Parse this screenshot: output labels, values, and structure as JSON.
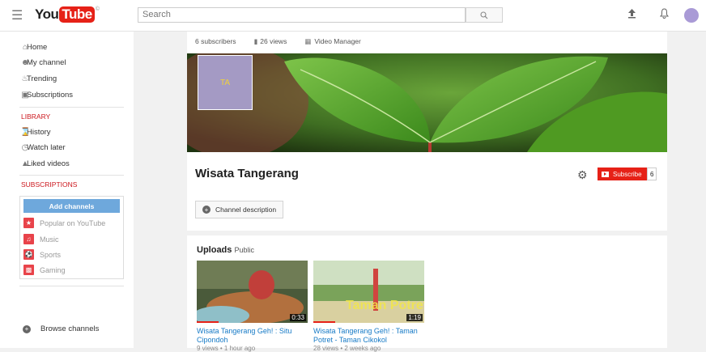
{
  "header": {
    "logo_you": "You",
    "logo_tube": "Tube",
    "search_placeholder": "Search"
  },
  "sidebar": {
    "nav": [
      {
        "label": "Home"
      },
      {
        "label": "My channel"
      },
      {
        "label": "Trending"
      },
      {
        "label": "Subscriptions"
      }
    ],
    "library_title": "LIBRARY",
    "library": [
      {
        "label": "History"
      },
      {
        "label": "Watch later"
      },
      {
        "label": "Liked videos"
      }
    ],
    "subscriptions_title": "SUBSCRIPTIONS",
    "add_channels": "Add channels",
    "subscriptions": [
      {
        "label": "Popular on YouTube",
        "color": "#e8434a"
      },
      {
        "label": "Music",
        "color": "#e8434a"
      },
      {
        "label": "Sports",
        "color": "#e8434a"
      },
      {
        "label": "Gaming",
        "color": "#e8434a"
      }
    ],
    "browse_channels": "Browse channels"
  },
  "channel": {
    "stats": {
      "subscribers": "6 subscribers",
      "views": "26 views",
      "manager": "Video Manager"
    },
    "thumb_text": "TA",
    "name": "Wisata Tangerang",
    "subscribe_label": "Subscribe",
    "subscriber_count": "6",
    "description_button": "Channel description"
  },
  "uploads": {
    "title": "Uploads",
    "visibility": "Public",
    "videos": [
      {
        "title": "Wisata Tangerang Geh! : Situ Cipondoh",
        "meta": "9 views • 1 hour ago",
        "duration": "0:33",
        "progress": 0.2
      },
      {
        "title": "Wisata Tangerang Geh! : Taman Potret - Taman Cikokol",
        "meta": "28 views • 2 weeks ago",
        "duration": "1:19",
        "progress": 0.2
      }
    ]
  }
}
